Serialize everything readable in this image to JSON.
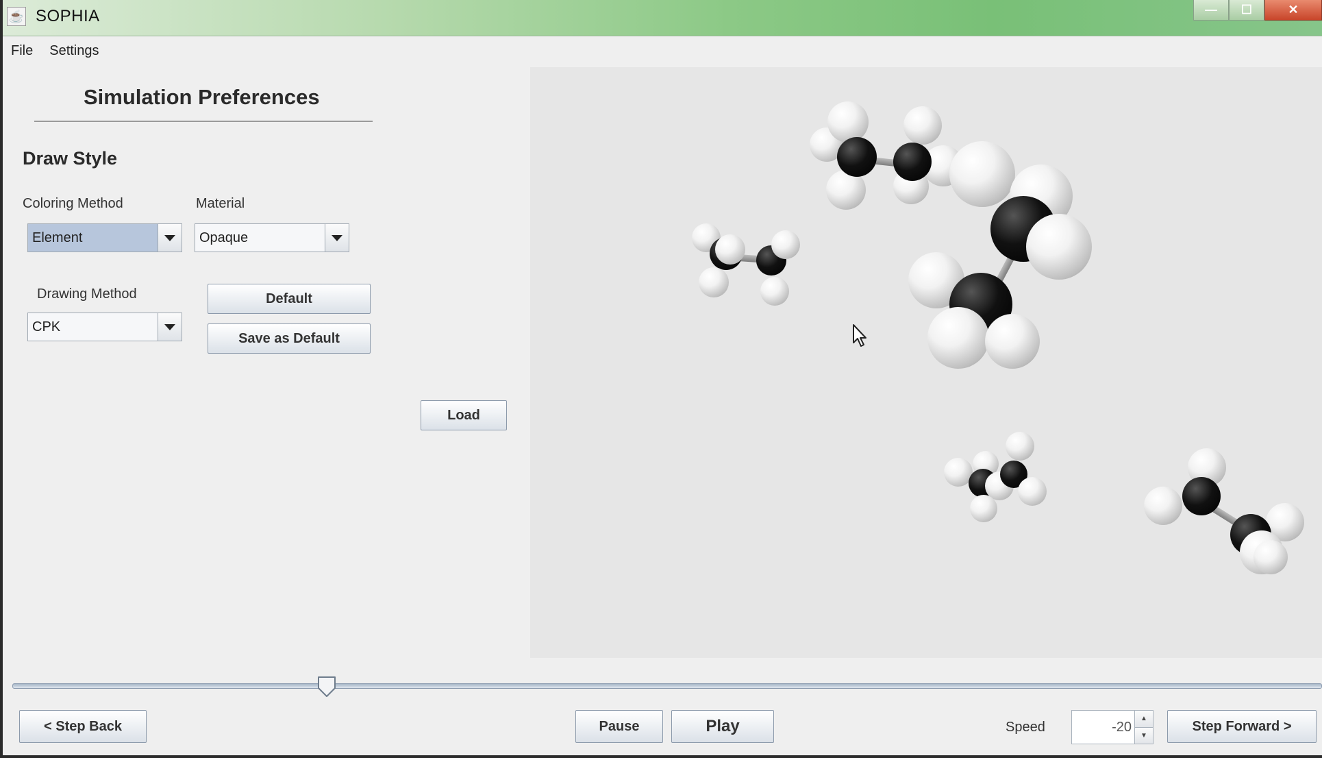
{
  "window": {
    "title": "SOPHIA",
    "icon": "java-cup-icon",
    "controls": {
      "minimize": "—",
      "maximize": "☐",
      "close": "✕"
    }
  },
  "menu": [
    "File",
    "Settings"
  ],
  "panel": {
    "heading": "Simulation Preferences",
    "section": "Draw Style",
    "coloring_method": {
      "label": "Coloring Method",
      "value": "Element"
    },
    "material": {
      "label": "Material",
      "value": "Opaque"
    },
    "drawing_method": {
      "label": "Drawing Method",
      "value": "CPK"
    },
    "default_label": "Default",
    "save_default_label": "Save as Default",
    "load_label": "Load"
  },
  "playback": {
    "slider_fraction": 0.24,
    "step_back": "< Step Back",
    "pause": "Pause",
    "play": "Play",
    "speed_label": "Speed",
    "speed_value": "-20",
    "step_forward": "Step Forward >"
  },
  "colors": {
    "hydrogen": "#f2f2f2",
    "carbon": "#000000",
    "viewport_bg": "#e6e6e6",
    "title_bar": "#8cc986"
  }
}
